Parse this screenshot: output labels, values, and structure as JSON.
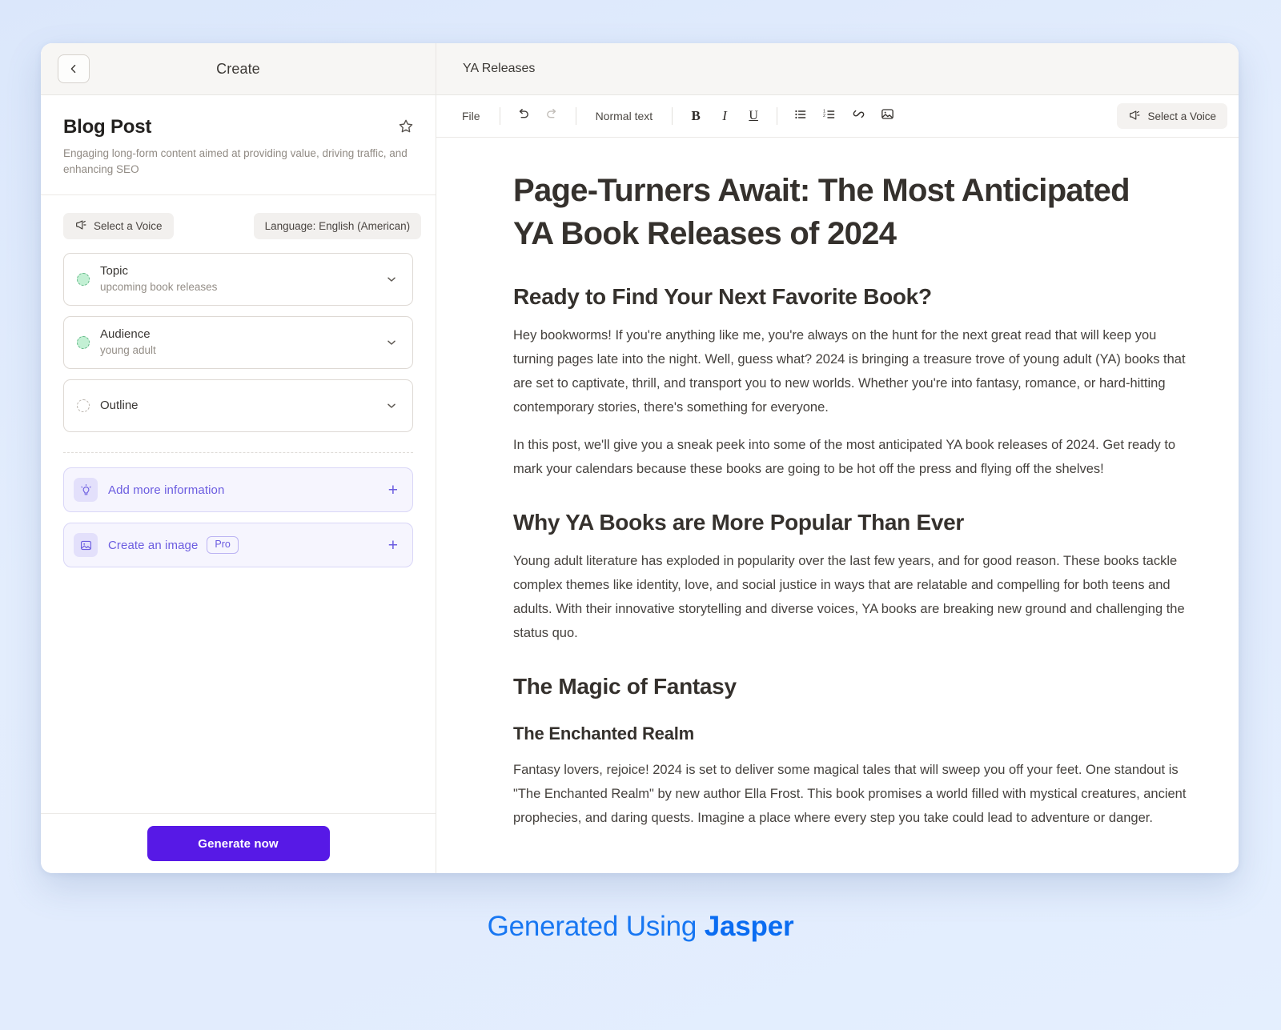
{
  "left_panel": {
    "header_title": "Create",
    "back_icon": "chevron-left-icon",
    "star_icon": "star-outline-icon",
    "template": {
      "title": "Blog Post",
      "description": "Engaging long-form content aimed at providing value, driving traffic, and enhancing SEO"
    },
    "pills": [
      {
        "label": "Select a Voice",
        "icon": "megaphone-icon"
      },
      {
        "label": "Language: English (American)",
        "icon": "none"
      }
    ],
    "fields": [
      {
        "label": "Topic",
        "value": "upcoming book releases",
        "state": "filled",
        "chevron": "chevron-down-icon"
      },
      {
        "label": "Audience",
        "value": "young adult",
        "state": "filled",
        "chevron": "chevron-down-icon"
      },
      {
        "label": "Outline",
        "value": "",
        "state": "empty",
        "chevron": "chevron-down-icon"
      }
    ],
    "actions": [
      {
        "label": "Add more information",
        "icon": "lightbulb-icon",
        "badge": "",
        "plus": "+"
      },
      {
        "label": "Create an image",
        "icon": "image-icon",
        "badge": "Pro",
        "plus": "+"
      }
    ],
    "generate_button": "Generate now"
  },
  "right_panel": {
    "doc_title": "YA Releases",
    "toolbar": {
      "file_label": "File",
      "undo_icon": "undo-icon",
      "redo_icon": "redo-icon",
      "style_label": "Normal text",
      "bold_label": "B",
      "italic_label": "I",
      "underline_label": "U",
      "bullet_list_icon": "bullet-list-icon",
      "numbered_list_icon": "numbered-list-icon",
      "link_icon": "link-icon",
      "image_icon": "image-icon",
      "voice_label": "Select a Voice",
      "voice_icon": "megaphone-icon"
    },
    "document": {
      "h1": "Page-Turners Await: The Most Anticipated YA Book Releases of 2024",
      "blocks": [
        {
          "type": "h2",
          "text": "Ready to Find Your Next Favorite Book?"
        },
        {
          "type": "p",
          "text": "Hey bookworms! If you're anything like me, you're always on the hunt for the next great read that will keep you turning pages late into the night. Well, guess what? 2024 is bringing a treasure trove of young adult (YA) books that are set to captivate, thrill, and transport you to new worlds. Whether you're into fantasy, romance, or hard-hitting contemporary stories, there's something for everyone."
        },
        {
          "type": "p",
          "text": "In this post, we'll give you a sneak peek into some of the most anticipated YA book releases of 2024. Get ready to mark your calendars because these books are going to be hot off the press and flying off the shelves!"
        },
        {
          "type": "h2",
          "text": "Why YA Books are More Popular Than Ever"
        },
        {
          "type": "p",
          "text": "Young adult literature has exploded in popularity over the last few years, and for good reason. These books tackle complex themes like identity, love, and social justice in ways that are relatable and compelling for both teens and adults. With their innovative storytelling and diverse voices, YA books are breaking new ground and challenging the status quo."
        },
        {
          "type": "h2",
          "text": "The Magic of Fantasy"
        },
        {
          "type": "h3",
          "text": "The Enchanted Realm"
        },
        {
          "type": "p",
          "text": "Fantasy lovers, rejoice! 2024 is set to deliver some magical tales that will sweep you off your feet. One standout is \"The Enchanted Realm\" by new author Ella Frost. This book promises a world filled with mystical creatures, ancient prophecies, and daring quests. Imagine a place where every step you take could lead to adventure or danger."
        }
      ]
    }
  },
  "branding": {
    "prefix": "Generated Using ",
    "name": "Jasper",
    "color": "#1877f2"
  }
}
